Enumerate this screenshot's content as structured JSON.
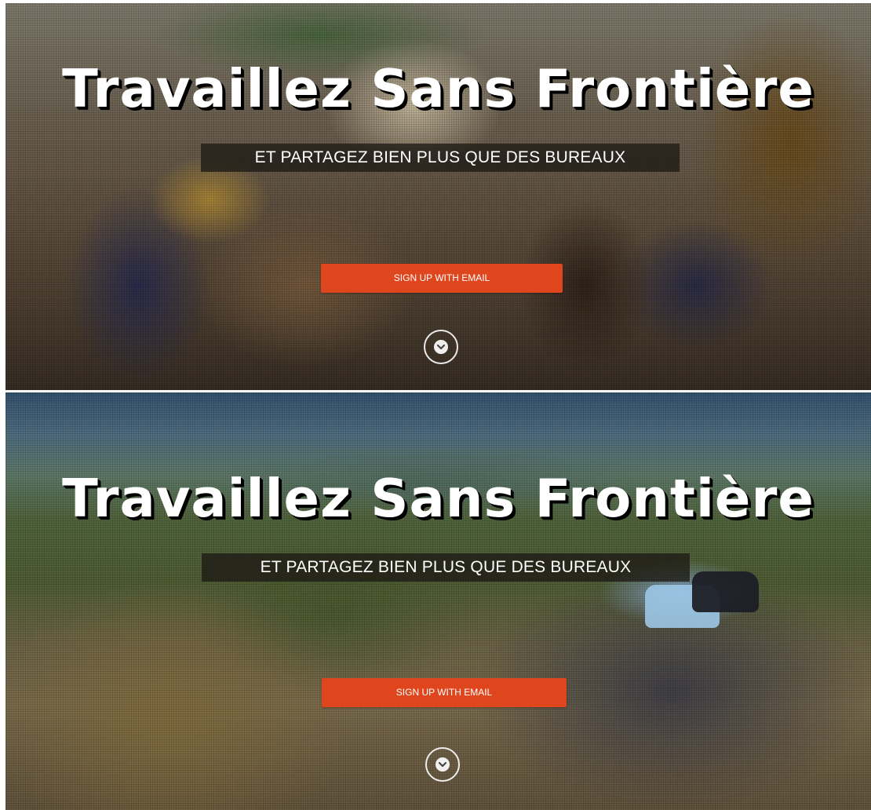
{
  "sections": [
    {
      "title": "Travaillez Sans Frontière",
      "subtitle": "ET PARTAGEZ BIEN PLUS QUE DES BUREAUX",
      "cta_label": "SIGN UP WITH EMAIL",
      "scroll_icon": "chevron-down-icon"
    },
    {
      "title": "Travaillez Sans Frontière",
      "subtitle": "ET PARTAGEZ BIEN PLUS QUE DES BUREAUX",
      "cta_label": "SIGN UP WITH EMAIL",
      "scroll_icon": "chevron-down-icon"
    }
  ],
  "colors": {
    "cta_background": "#e0461d",
    "subtitle_band": "#1e1914",
    "text": "#ffffff"
  }
}
